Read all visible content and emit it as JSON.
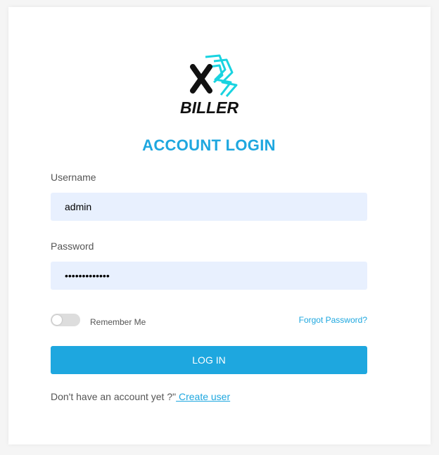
{
  "logo": {
    "text": "BILLER",
    "icon": "xbiller-logo"
  },
  "title": "ACCOUNT LOGIN",
  "username": {
    "label": "Username",
    "value": "admin"
  },
  "password": {
    "label": "Password",
    "value": "•••••••••••••"
  },
  "remember": {
    "label": "Remember Me",
    "checked": false
  },
  "forgot": {
    "label": "Forgot Password?"
  },
  "login_button": {
    "label": "LOG IN"
  },
  "footer": {
    "prompt": "Don't have an account yet ?\"",
    "link": " Create user"
  },
  "colors": {
    "accent": "#1ea7df",
    "input_bg": "#e8f0fe",
    "toggle_off": "#dddddd"
  }
}
